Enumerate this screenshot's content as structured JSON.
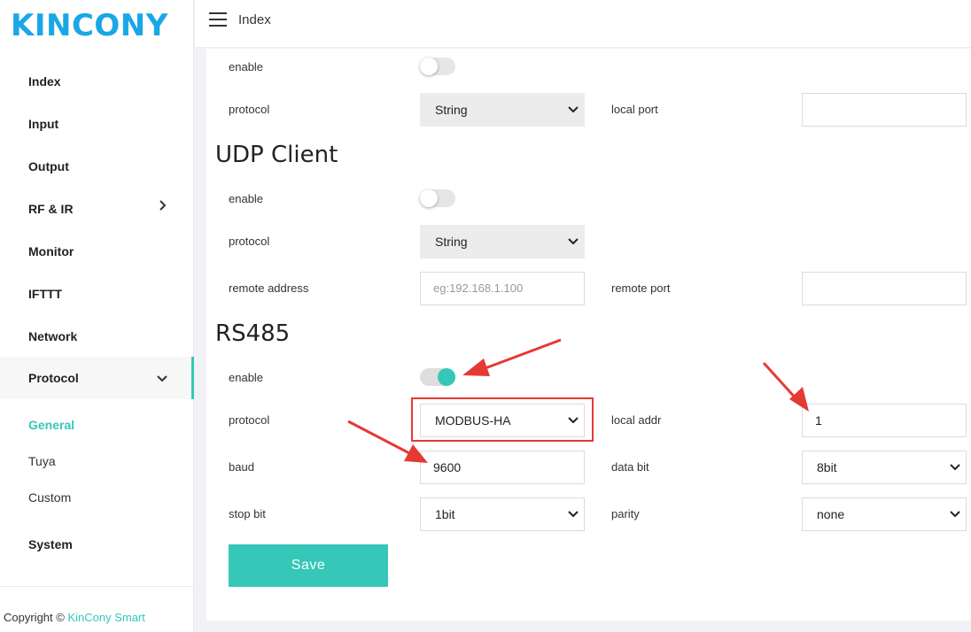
{
  "brand": {
    "logo_text": "KINCONY"
  },
  "sidebar": {
    "items": [
      {
        "label": "Index"
      },
      {
        "label": "Input"
      },
      {
        "label": "Output"
      },
      {
        "label": "RF & IR"
      },
      {
        "label": "Monitor"
      },
      {
        "label": "IFTTT"
      },
      {
        "label": "Network"
      },
      {
        "label": "Protocol"
      },
      {
        "label": "System"
      }
    ],
    "protocol_sub": [
      {
        "label": "General"
      },
      {
        "label": "Tuya"
      },
      {
        "label": "Custom"
      }
    ]
  },
  "footer": {
    "copyright": "Copyright ©",
    "brand": "KinCony Smart"
  },
  "header": {
    "title": "Index"
  },
  "udp_server": {
    "enable_label": "enable",
    "enabled": false,
    "protocol_label": "protocol",
    "protocol_value": "String",
    "local_port_label": "local port",
    "local_port_value": ""
  },
  "udp_client": {
    "title": "UDP Client",
    "enable_label": "enable",
    "enabled": false,
    "protocol_label": "protocol",
    "protocol_value": "String",
    "remote_address_label": "remote address",
    "remote_address_placeholder": "eg:192.168.1.100",
    "remote_port_label": "remote port",
    "remote_port_value": ""
  },
  "rs485": {
    "title": "RS485",
    "enable_label": "enable",
    "enabled": true,
    "protocol_label": "protocol",
    "protocol_value": "MODBUS-HA",
    "local_addr_label": "local addr",
    "local_addr_value": "1",
    "baud_label": "baud",
    "baud_value": "9600",
    "data_bit_label": "data bit",
    "data_bit_value": "8bit",
    "stop_bit_label": "stop bit",
    "stop_bit_value": "1bit",
    "parity_label": "parity",
    "parity_value": "none"
  },
  "actions": {
    "save_label": "Save"
  },
  "colors": {
    "accent": "#35c7b8",
    "logo": "#1aa7e5",
    "annotation": "#e53935"
  }
}
